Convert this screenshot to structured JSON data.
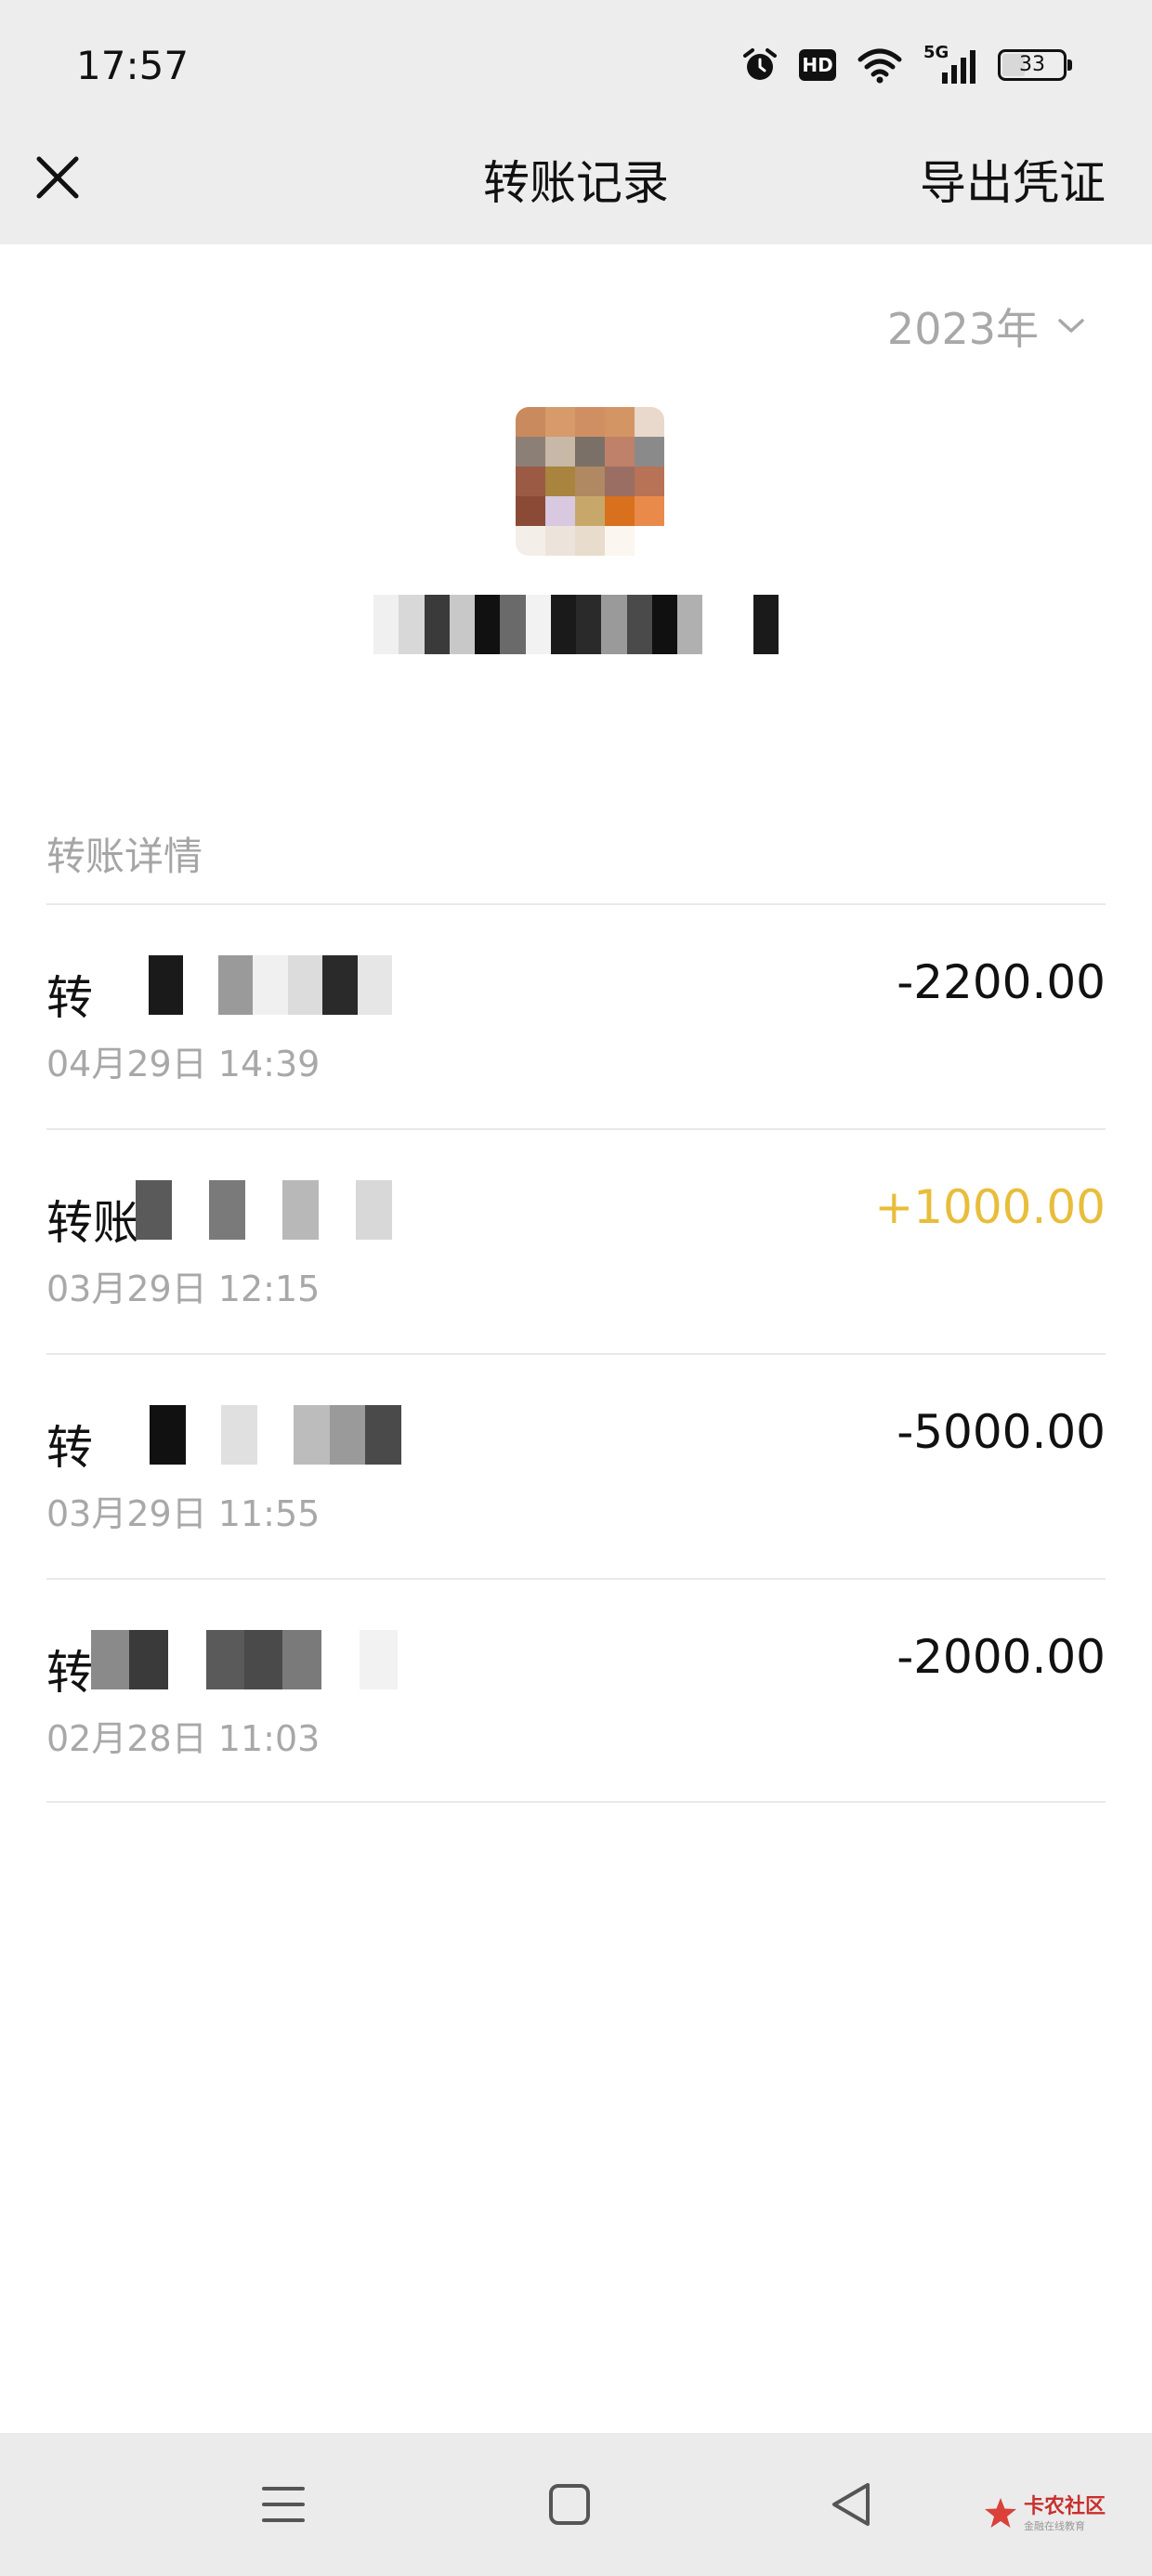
{
  "status_bar": {
    "time": "17:57",
    "icons": [
      "alarm-icon",
      "hd-icon",
      "wifi-icon",
      "5g-signal-icon",
      "battery-icon"
    ],
    "hd_label": "HD",
    "network_label": "5G",
    "battery_percent": "33"
  },
  "header": {
    "title": "转账记录",
    "export_label": "导出凭证",
    "close_icon": "close-icon"
  },
  "filter": {
    "year": "2023年",
    "chevron_icon": "chevron-down-icon"
  },
  "section": {
    "label": "转账详情"
  },
  "transactions": [
    {
      "title": "转",
      "date": "04月29日 14:39",
      "amount": "-2200.00",
      "type": "expense"
    },
    {
      "title": "转账",
      "date": "03月29日 12:15",
      "amount": "+1000.00",
      "type": "income"
    },
    {
      "title": "转",
      "date": "03月29日 11:55",
      "amount": "-5000.00",
      "type": "expense"
    },
    {
      "title": "转",
      "date": "02月28日 11:03",
      "amount": "-2000.00",
      "type": "expense"
    }
  ],
  "bottom_nav": {
    "icons": [
      "menu-icon",
      "home-icon",
      "back-icon"
    ]
  },
  "watermark": {
    "line1": "卡农社区",
    "line2": "金融在线教育"
  },
  "colors": {
    "header_bg": "#ededed",
    "income": "#e8bd3a",
    "muted_text": "#a8a8a8",
    "divider": "#e9e9e9"
  }
}
